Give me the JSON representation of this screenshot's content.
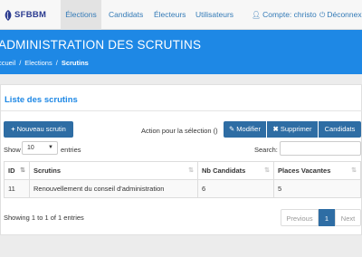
{
  "brand": {
    "name": "SFBBM"
  },
  "nav": {
    "items": [
      {
        "label": "Élections"
      },
      {
        "label": "Candidats"
      },
      {
        "label": "Électeurs"
      },
      {
        "label": "Utilisateurs"
      }
    ],
    "account_label": "Compte: christo",
    "logout_label": "Déconnexio"
  },
  "header": {
    "title": "ADMINISTRATION DES SCRUTINS",
    "breadcrumb": [
      "ccueil",
      "Elections",
      "Scrutins"
    ]
  },
  "panel": {
    "title": "Liste des scrutins",
    "new_button": "Nouveau scrutin",
    "selection_label": "Action pour la sélection ()",
    "modify_button": "Modifier",
    "delete_button": "Supprimer",
    "candidates_button": "Candidats"
  },
  "table_controls": {
    "show_label": "Show",
    "page_size": "10",
    "entries_label": "entries",
    "search_label": "Search:"
  },
  "table": {
    "headers": [
      "ID",
      "Scrutins",
      "Nb Candidats",
      "Places Vacantes"
    ],
    "rows": [
      [
        "11",
        "Renouvellement du conseil d'administration",
        "6",
        "5"
      ]
    ]
  },
  "footer": {
    "info": "Showing 1 to 1 of 1 entries",
    "prev": "Previous",
    "current_page": "1",
    "next": "Next"
  },
  "colors": {
    "accent": "#1e88e5",
    "button": "#2e6da4"
  }
}
